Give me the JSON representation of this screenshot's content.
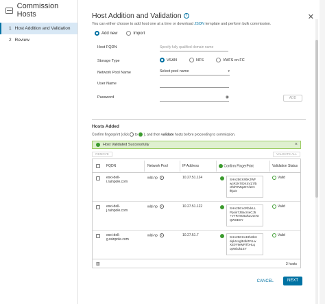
{
  "wizard": {
    "title": "Commission Hosts",
    "steps": [
      {
        "num": "1",
        "label": "Host Addition and Validation"
      },
      {
        "num": "2",
        "label": "Review"
      }
    ]
  },
  "main": {
    "title": "Host Addition and Validation",
    "desc_prefix": "You can either choose to add host one at a time or download ",
    "desc_link": "JSON",
    "desc_suffix": " template and perform bulk commission.",
    "mode": {
      "add_new": "Add new",
      "import": "Import"
    },
    "form": {
      "fqdn_label": "Host FQDN",
      "fqdn_placeholder": "Specify fully qualified domain name",
      "storage_label": "Storage Type",
      "storage_options": [
        "VSAN",
        "NFS",
        "VMFS on FC"
      ],
      "netpool_label": "Network Pool Name",
      "netpool_value": "Select pool name",
      "username_label": "User Name",
      "password_label": "Password",
      "add_button": "ADD"
    },
    "hosts": {
      "title": "Hosts Added",
      "confirm_a": "Confirm fingerprint (click",
      "confirm_b": "to",
      "confirm_c": "), and then",
      "confirm_bold": "validate",
      "confirm_d": "hosts before proceeding to commission.",
      "alert": "Host Validated Successfully",
      "remove_btn": "REMOVE",
      "validate_all_btn": "VALIDATE ALL",
      "columns": [
        "FQDN",
        "Network Pool",
        "IP Address",
        "Confirm FingerPrint",
        "Validation Status"
      ],
      "rows": [
        {
          "fqdn1": "esxi-dell-",
          "fqdn2": "i.rainpole.com",
          "pool": "wld-np",
          "ip": "10.27.51.124",
          "fp": [
            "SHA256:K9bKJWF",
            "wcRzNT/DKSVZ7/b",
            "cthiR7MqvDY/aHv",
            "flfpdz"
          ],
          "status": "Valid"
        },
        {
          "fqdn1": "esxi-dell-",
          "fqdn2": "j.rainpole.com",
          "pool": "wld-np",
          "ip": "10.27.51.122",
          "fp": [
            "SHA256:ncRbdvLL",
            "Ppsin7JBacr4eCJ5",
            "+VYR78OBJkLUU7D",
            "QWSESY"
          ],
          "status": "Valid"
        },
        {
          "fqdn1": "esxi-dell-",
          "fqdn2": "g.rainpole.com",
          "pool": "wld-np",
          "ip": "10.27.51.7",
          "fp": [
            "SHA256:Kx19hUbH",
            "dqkJxcglEdk/RYLw",
            "XE0Y9eMRTbHLq",
            "opWbJk1EY"
          ],
          "status": "Valid"
        }
      ],
      "footer_count": "3 hosts"
    },
    "footer": {
      "cancel": "CANCEL",
      "next": "NEXT"
    }
  }
}
